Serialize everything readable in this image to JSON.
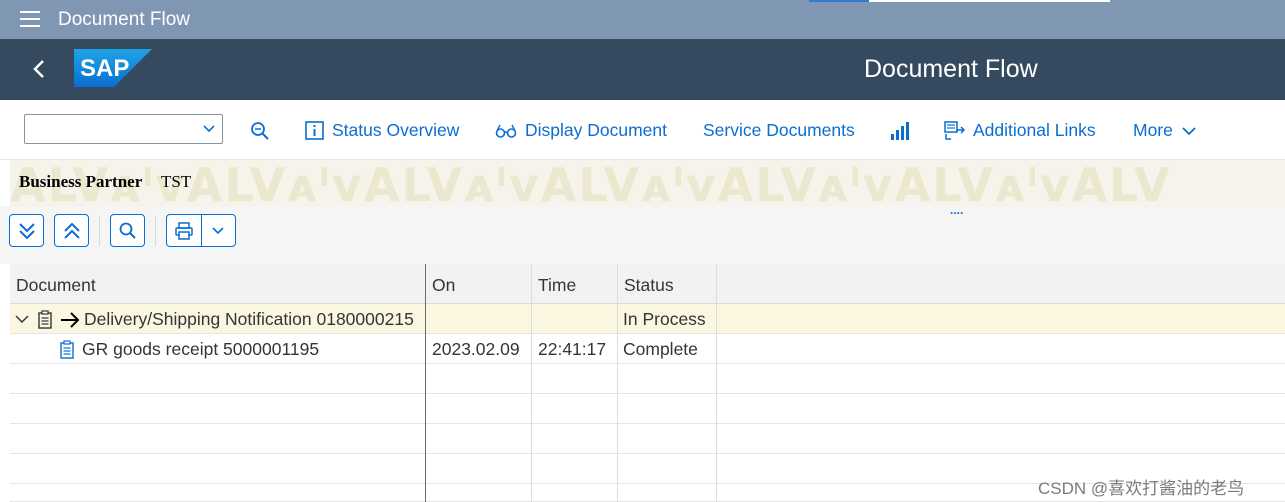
{
  "shell": {
    "title": "Document Flow"
  },
  "header": {
    "app_title": "Document Flow",
    "logo_text": "SAP"
  },
  "toolbar": {
    "select_value": "",
    "status_overview": "Status Overview",
    "display_document": "Display Document",
    "service_documents": "Service Documents",
    "additional_links": "Additional Links",
    "more": "More"
  },
  "alv_header": {
    "watermark": "ALVᴀᴵᴠALVᴀᴵᴠALVᴀᴵᴠALVᴀᴵᴠALVᴀᴵᴠALVᴀᴵᴠALV",
    "business_partner_label": "Business Partner",
    "business_partner_value": "TST"
  },
  "table": {
    "columns": [
      "Document",
      "On",
      "Time",
      "Status"
    ],
    "rows": [
      {
        "document": "Delivery/Shipping Notification 0180000215",
        "on": "",
        "time": "",
        "status": "In Process"
      },
      {
        "document": "GR goods receipt 5000001195",
        "on": "2023.02.09",
        "time": "22:41:17",
        "status": "Complete"
      }
    ]
  },
  "footer_watermark": "CSDN @喜欢打酱油的老鸟",
  "colors": {
    "shell": "#7f97b3",
    "header": "#354a5f",
    "accent": "#0a6ed1"
  }
}
